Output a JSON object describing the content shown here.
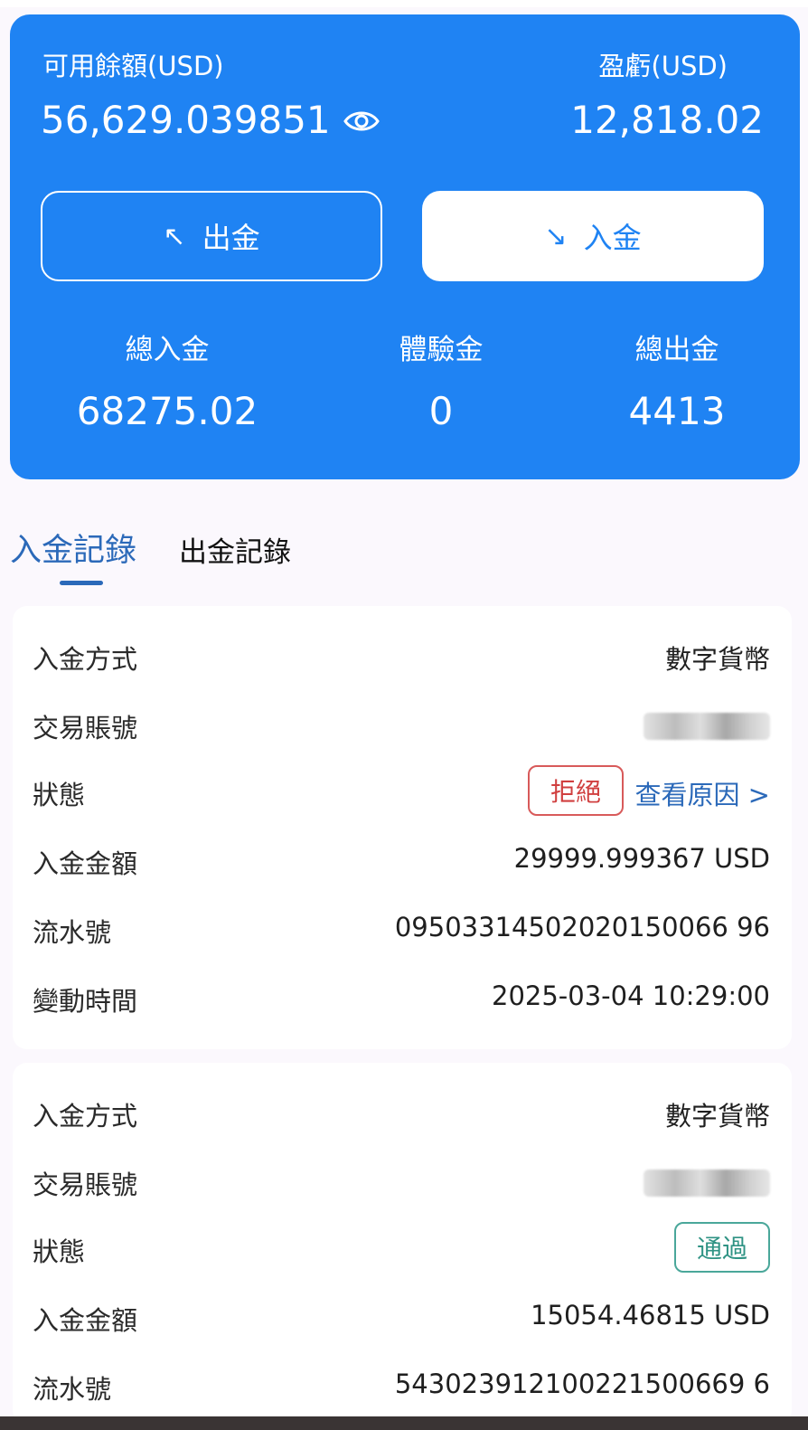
{
  "balance_card": {
    "available_label": "可用餘額(USD)",
    "available_value": "56,629.039851",
    "pnl_label": "盈虧(USD)",
    "pnl_value": "12,818.02",
    "withdraw_button": "出金",
    "deposit_button": "入金",
    "withdraw_arrow": "↖",
    "deposit_arrow": "↘",
    "stats": [
      {
        "label": "總入金",
        "value": "68275.02"
      },
      {
        "label": "體驗金",
        "value": "0"
      },
      {
        "label": "總出金",
        "value": "4413"
      }
    ],
    "card_color": "#1f83f3"
  },
  "tabs": [
    {
      "label": "入金記錄",
      "active": true
    },
    {
      "label": "出金記錄",
      "active": false
    }
  ],
  "records": [
    {
      "method_label": "入金方式",
      "method": "數字貨幣",
      "account_label": "交易賬號",
      "status_label": "狀態",
      "status": "拒絕",
      "reason_link": "查看原因 >",
      "amount_label": "入金金額",
      "amount": "29999.999367 USD",
      "serial_label": "流水號",
      "serial": "09503314502020150066 96",
      "time_label": "變動時間",
      "time": "2025-03-04 10:29:00"
    },
    {
      "method_label": "入金方式",
      "method": "數字貨幣",
      "account_label": "交易賬號",
      "status_label": "狀態",
      "status": "通過",
      "amount_label": "入金金額",
      "amount": "15054.46815 USD",
      "serial_label": "流水號",
      "serial": "543023912100221500669 6"
    }
  ]
}
